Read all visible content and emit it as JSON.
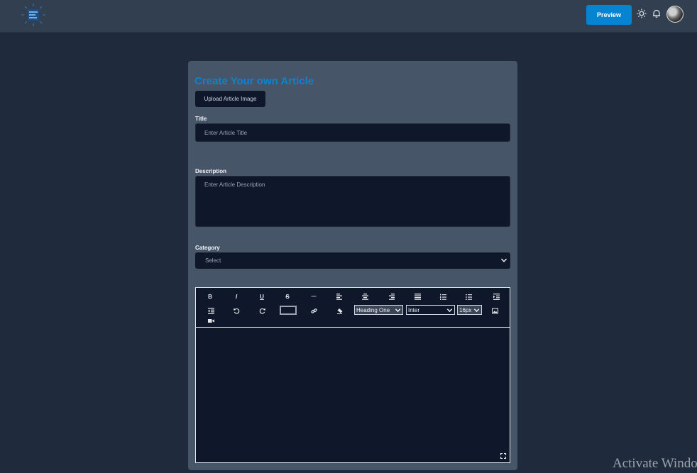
{
  "navbar": {
    "preview_label": "Preview",
    "icons": [
      "logo-icon",
      "sun-icon",
      "bell-icon",
      "avatar"
    ]
  },
  "form": {
    "title": "Create Your own Article",
    "upload_label": "Upload Article Image",
    "title_label": "Title",
    "title_placeholder": "Enter Article Title",
    "description_label": "Description",
    "description_placeholder": "Enter Article Description",
    "category_label": "Category",
    "category_value": "Select"
  },
  "editor": {
    "bold": "B",
    "italic": "I",
    "underline": "U",
    "strike": "S",
    "hr": "—",
    "heading_value": "Heading One",
    "font_value": "Inter",
    "size_value": "16px",
    "text_color": "#0f172a"
  },
  "colors": {
    "accent": "#0784d1",
    "background": "#1f2a3c",
    "card": "#475569",
    "field": "#0f172a"
  },
  "watermark": "Activate Windows"
}
